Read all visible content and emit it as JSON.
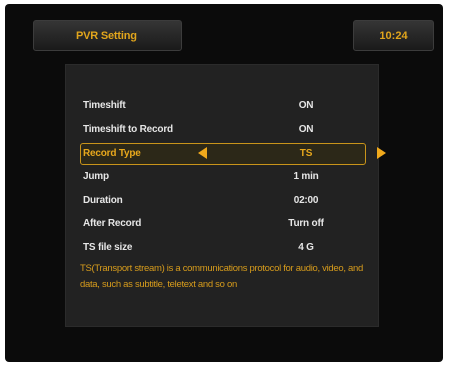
{
  "header": {
    "title": "PVR Setting",
    "clock": "10:24"
  },
  "settings": [
    {
      "label": "Timeshift",
      "value": "ON"
    },
    {
      "label": "Timeshift to Record",
      "value": "ON"
    },
    {
      "label": "Record Type",
      "value": "TS",
      "selected": true
    },
    {
      "label": "Jump",
      "value": "1 min"
    },
    {
      "label": "Duration",
      "value": "02:00"
    },
    {
      "label": "After Record",
      "value": "Turn off"
    },
    {
      "label": "TS file size",
      "value": "4 G"
    }
  ],
  "help_text": "TS(Transport stream) is a communications protocol for audio, video, and data, such as subtitle, teletext and so on",
  "colors": {
    "accent": "#e1a51c",
    "background": "#0b0b0b",
    "panel": "#222222",
    "text": "#e6e6e6"
  },
  "icons": {
    "prev": "arrow-left-icon",
    "next": "arrow-right-icon"
  }
}
